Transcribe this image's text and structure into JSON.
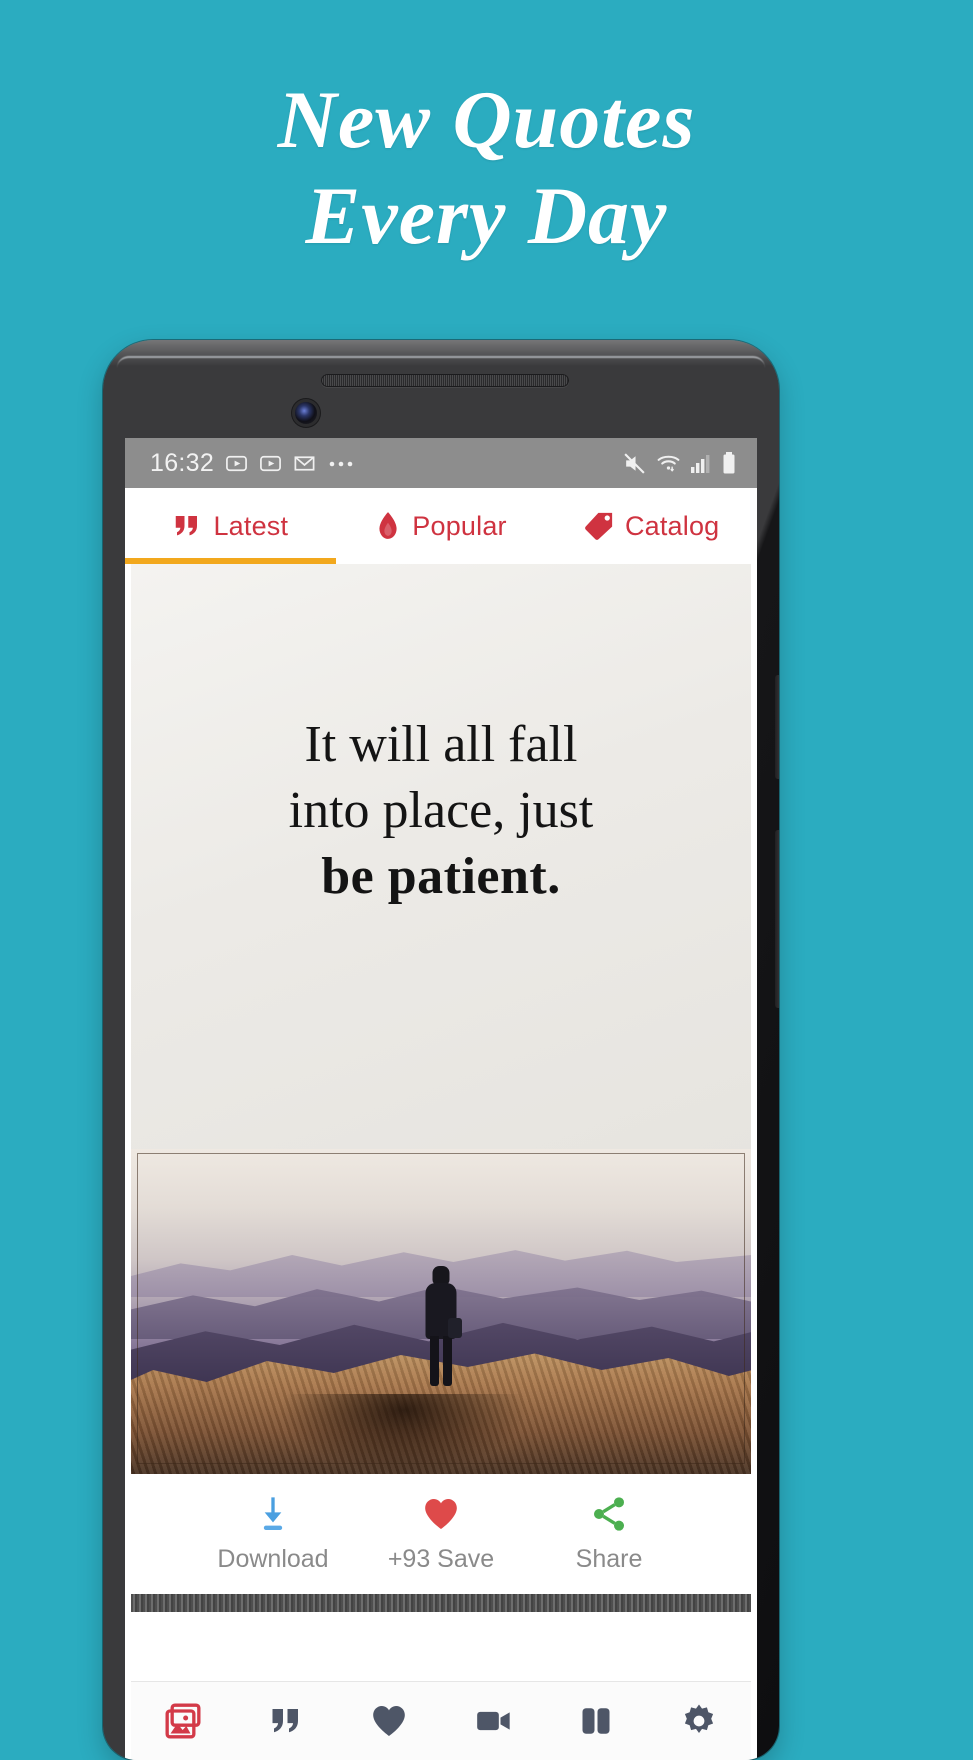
{
  "promo": {
    "background_color": "#2BACC0",
    "headline_lines": [
      "New Quotes",
      "Every Day"
    ]
  },
  "phone": {
    "status_bar": {
      "time": "16:32",
      "left_icons": [
        "youtube-icon",
        "youtube-icon",
        "gmail-icon",
        "overflow-dots-icon"
      ],
      "right_icons": [
        "mute-icon",
        "wifi-icon",
        "signal-icon",
        "battery-icon"
      ],
      "background_color": "#8d8d8d"
    },
    "tabs": {
      "accent_color": "#cf3340",
      "indicator_color": "#F2A81D",
      "active_index": 0,
      "items": [
        {
          "label": "Latest",
          "icon": "quote-marks-icon"
        },
        {
          "label": "Popular",
          "icon": "flame-icon"
        },
        {
          "label": "Catalog",
          "icon": "price-tag-icon"
        }
      ]
    },
    "quote_card": {
      "lines": [
        "It will all fall",
        "into place, just",
        "be patient."
      ],
      "bold_line_index": 2,
      "photo_alt": "person standing on mountain summit at sunrise",
      "watermark": ""
    },
    "actions": [
      {
        "label": "Download",
        "icon": "download-arrow-icon",
        "color": "#4a9fe0"
      },
      {
        "label": "+93 Save",
        "icon": "heart-icon",
        "color": "#de4a4a"
      },
      {
        "label": "Share",
        "icon": "share-nodes-icon",
        "color": "#4caf50"
      }
    ],
    "bottom_nav": [
      {
        "icon": "gallery-icon",
        "active": true,
        "color": "#d33a48"
      },
      {
        "icon": "quote-marks-icon",
        "active": false,
        "color": "#4e5667"
      },
      {
        "icon": "heart-icon",
        "active": false,
        "color": "#4e5667"
      },
      {
        "icon": "video-camera-icon",
        "active": false,
        "color": "#4e5667"
      },
      {
        "icon": "book-icon",
        "active": false,
        "color": "#4e5667"
      },
      {
        "icon": "gear-icon",
        "active": false,
        "color": "#4e5667"
      }
    ]
  }
}
